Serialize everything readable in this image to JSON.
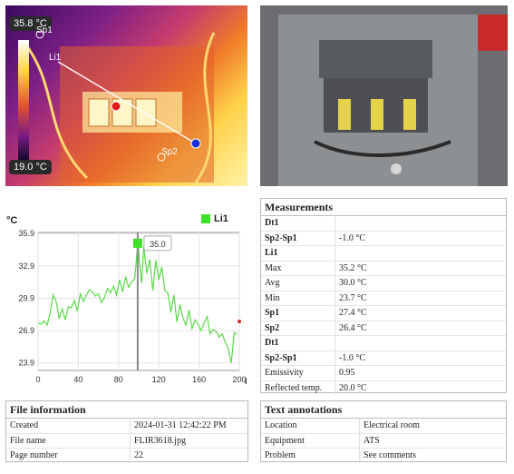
{
  "thermal_image": {
    "max_temp": "35.8 °C",
    "min_temp": "19.0 °C",
    "labels": {
      "sp1": "Sp1",
      "sp2": "Sp2",
      "li1": "Li1"
    }
  },
  "measurements": {
    "title": "Measurements",
    "rows": [
      {
        "key": "Dt1",
        "value": "",
        "bold": true
      },
      {
        "key": "Sp2-Sp1",
        "value": "-1.0 °C",
        "bold": true
      },
      {
        "key": "Li1",
        "value": "",
        "bold": true
      },
      {
        "key": "Max",
        "value": "35.2 °C",
        "bold": false
      },
      {
        "key": "Avg",
        "value": "30.0 °C",
        "bold": false
      },
      {
        "key": "Min",
        "value": "23.7 °C",
        "bold": false
      },
      {
        "key": "Sp1",
        "value": "27.4 °C",
        "bold": true
      },
      {
        "key": "Sp2",
        "value": "26.4 °C",
        "bold": true
      },
      {
        "key": "Dt1",
        "value": "",
        "bold": true
      },
      {
        "key": "Sp2-Sp1",
        "value": "-1.0 °C",
        "bold": true
      },
      {
        "key": "Emissivity",
        "value": "0.95",
        "bold": false
      },
      {
        "key": "Reflected temp.",
        "value": "20.0 °C",
        "bold": false
      }
    ]
  },
  "file_info": {
    "title": "File information",
    "rows": [
      {
        "key": "Created",
        "value": "2024-01-31 12:42:22 PM"
      },
      {
        "key": "File name",
        "value": "FLIR3618.jpg"
      },
      {
        "key": "Page number",
        "value": "22"
      }
    ]
  },
  "text_annotations": {
    "title": "Text annotations",
    "rows": [
      {
        "key": "Location",
        "value": "Electrical room"
      },
      {
        "key": "Equipment",
        "value": "ATS"
      },
      {
        "key": "Problem",
        "value": "See comments"
      }
    ]
  },
  "chart_data": {
    "type": "line",
    "ylabel": "°C",
    "xlabel": "px",
    "x_ticks": [
      "0",
      "40",
      "80",
      "120",
      "160",
      "200"
    ],
    "y_ticks": [
      "23.9",
      "26.9",
      "29.9",
      "32.9",
      "35.9"
    ],
    "xlim": [
      0,
      200
    ],
    "ylim": [
      23.2,
      36.0
    ],
    "series": [
      {
        "name": "Li1",
        "color": "#5bd84a",
        "x": [
          0,
          3,
          6,
          9,
          12,
          15,
          18,
          21,
          24,
          27,
          30,
          33,
          36,
          39,
          42,
          45,
          48,
          51,
          54,
          57,
          60,
          63,
          66,
          69,
          72,
          75,
          78,
          81,
          84,
          87,
          90,
          93,
          96,
          98,
          99,
          100,
          101,
          103,
          105,
          108,
          111,
          114,
          117,
          120,
          123,
          126,
          129,
          132,
          135,
          138,
          141,
          144,
          147,
          150,
          153,
          156,
          159,
          162,
          165,
          168,
          171,
          174,
          177,
          180,
          183,
          186,
          189,
          192,
          195,
          198
        ],
        "y": [
          27.6,
          27.5,
          27.8,
          27.4,
          28.5,
          30.2,
          29.6,
          28.0,
          28.9,
          27.9,
          29.1,
          29.0,
          29.7,
          28.7,
          30.3,
          29.6,
          30.2,
          30.7,
          30.5,
          30.1,
          30.3,
          29.5,
          30.0,
          30.8,
          30.4,
          31.0,
          30.2,
          31.6,
          30.5,
          31.9,
          30.9,
          31.4,
          31.7,
          33.8,
          35.0,
          34.4,
          33.0,
          31.3,
          34.7,
          32.2,
          33.5,
          30.6,
          33.4,
          31.6,
          32.8,
          30.6,
          30.4,
          28.6,
          30.2,
          27.7,
          29.3,
          28.1,
          27.4,
          28.8,
          27.1,
          27.9,
          27.5,
          26.9,
          27.6,
          28.2,
          26.6,
          27.0,
          26.8,
          26.3,
          26.6,
          25.8,
          25.2,
          23.9,
          26.7,
          26.6
        ]
      }
    ],
    "marker": {
      "x": 99,
      "y": 35.0,
      "label": "35.0"
    }
  }
}
